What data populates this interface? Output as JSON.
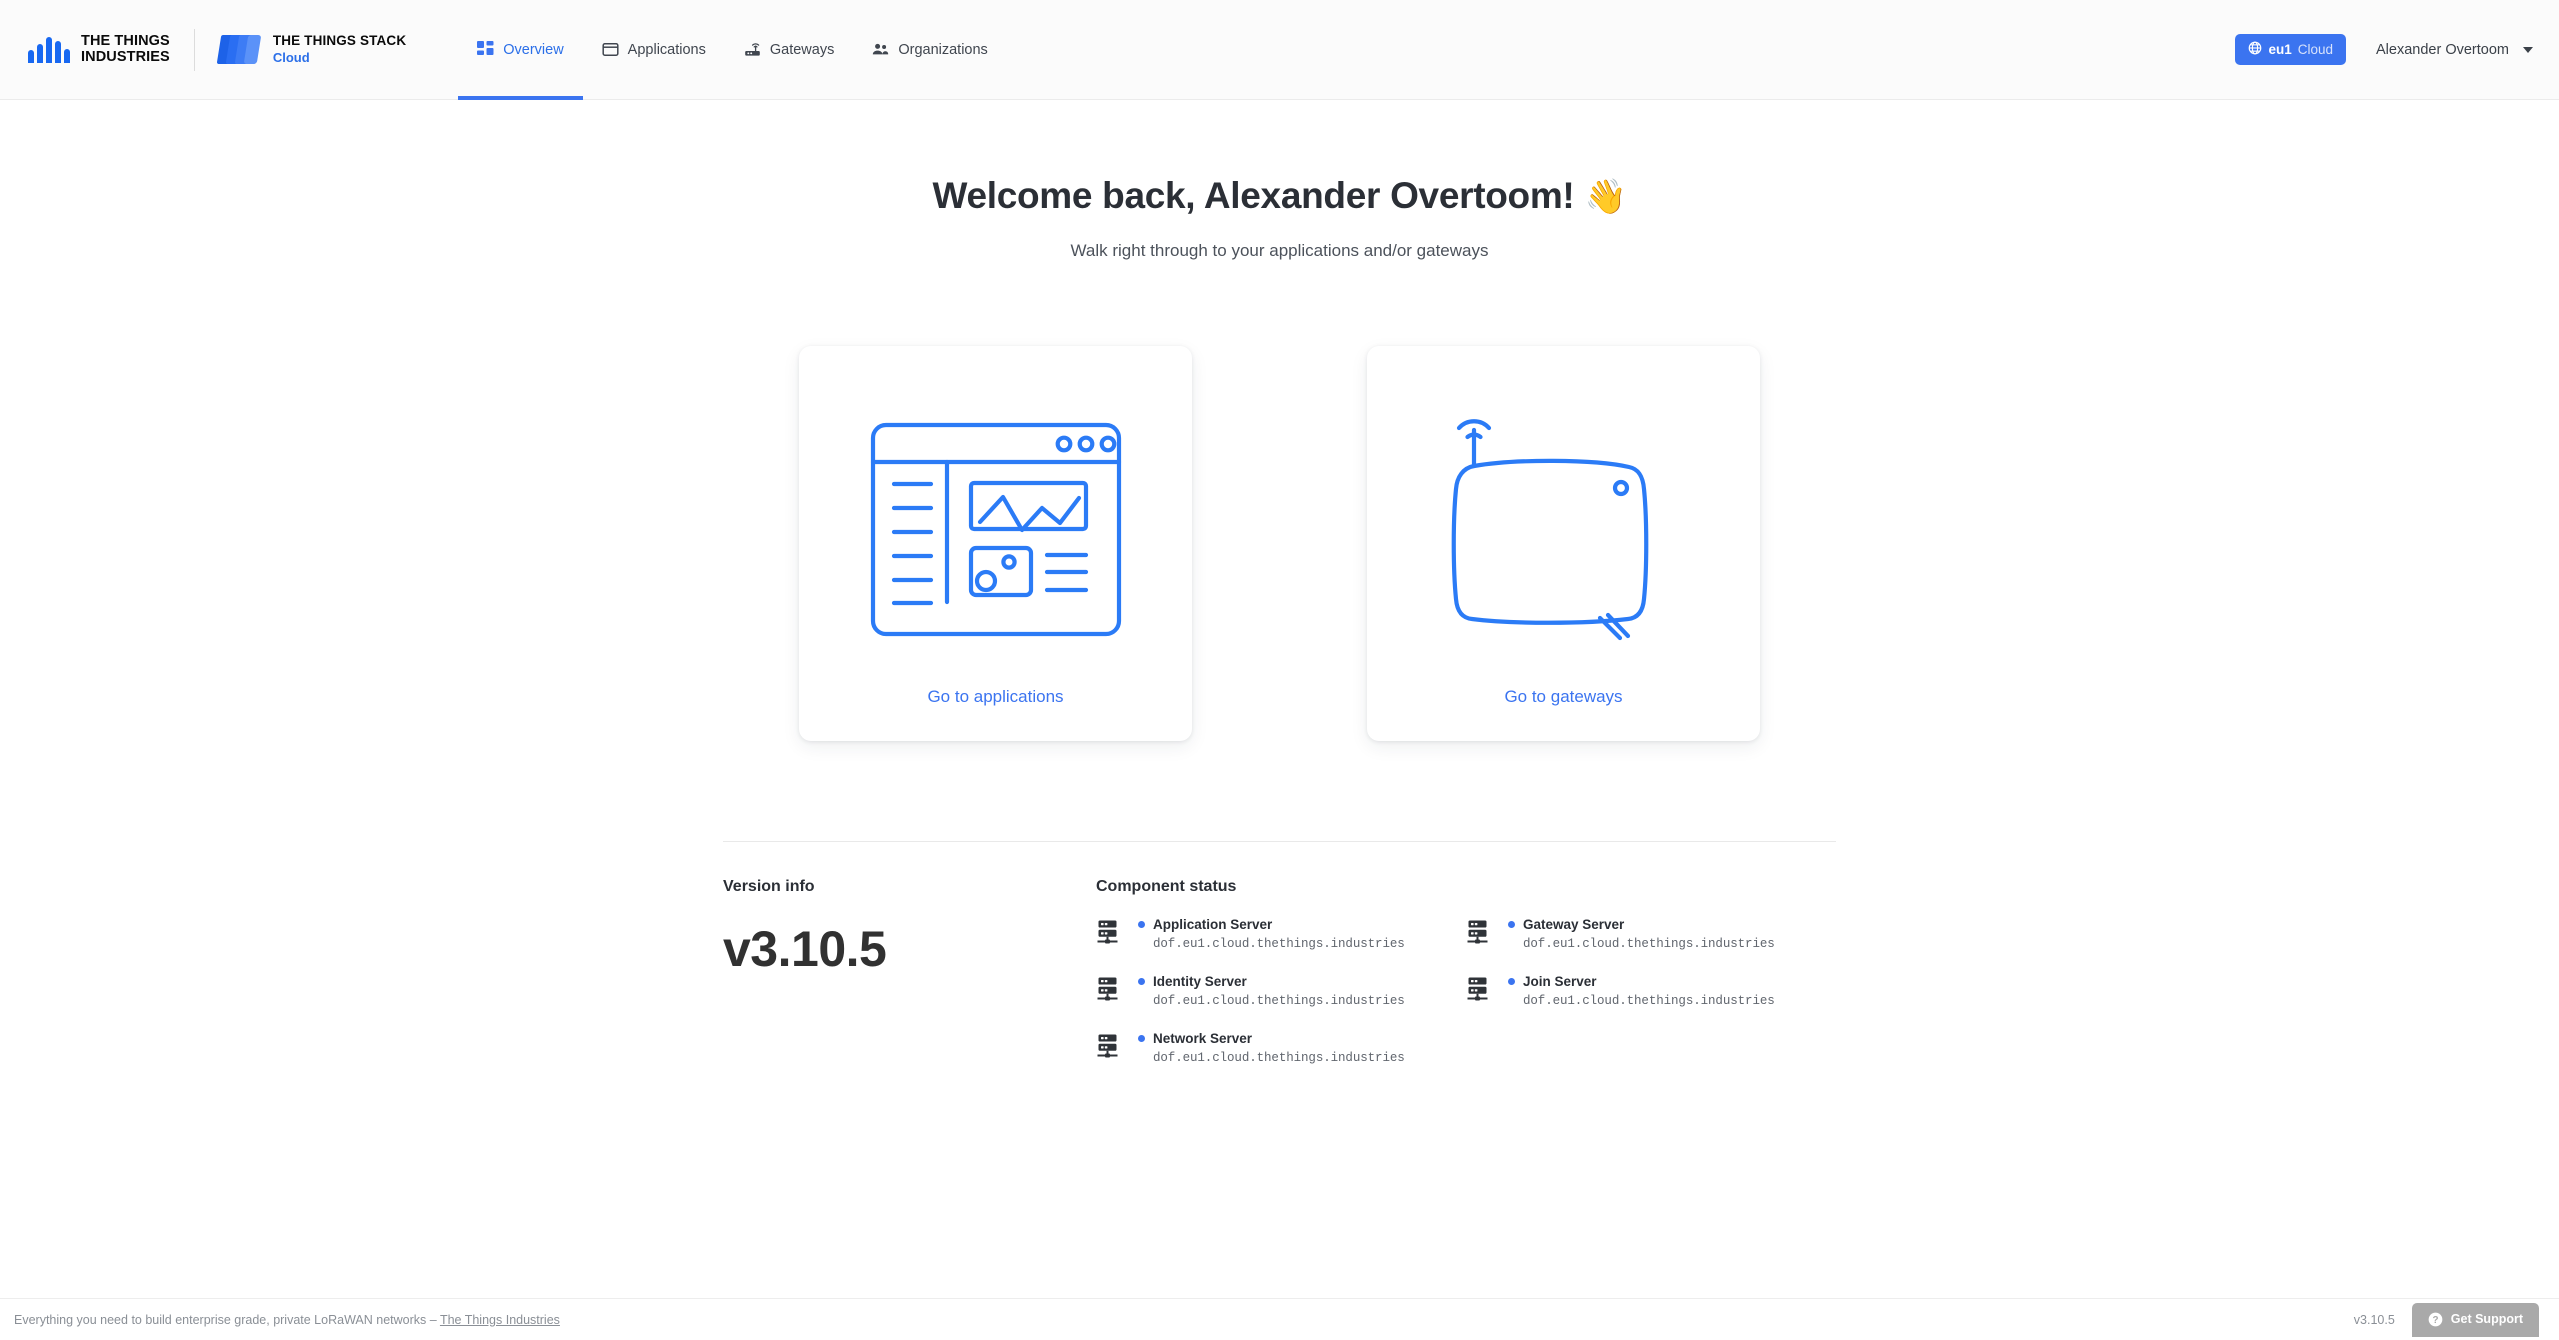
{
  "header": {
    "brand": {
      "tti_line1": "THE THINGS",
      "tti_line2": "INDUSTRIES",
      "stack_title": "THE THINGS STACK",
      "stack_sub": "Cloud"
    },
    "nav": [
      {
        "label": "Overview",
        "icon": "grid-icon",
        "active": true
      },
      {
        "label": "Applications",
        "icon": "window-icon",
        "active": false
      },
      {
        "label": "Gateways",
        "icon": "router-icon",
        "active": false
      },
      {
        "label": "Organizations",
        "icon": "people-icon",
        "active": false
      }
    ],
    "cluster_badge": {
      "region": "eu1",
      "tier": "Cloud",
      "icon": "globe-icon"
    },
    "user": {
      "name": "Alexander Overtoom",
      "caret": "chevron-down-icon"
    }
  },
  "main": {
    "welcome_title": "Welcome back, Alexander Overtoom!",
    "welcome_emoji": "👋",
    "subtitle": "Walk right through to your applications and/or gateways",
    "cards": [
      {
        "link_label": "Go to applications",
        "art": "applications-illustration"
      },
      {
        "link_label": "Go to gateways",
        "art": "gateway-illustration"
      }
    ]
  },
  "info": {
    "version_heading": "Version info",
    "version_value": "v3.10.5",
    "component_heading": "Component status",
    "components": [
      {
        "name": "Application Server",
        "host": "dof.eu1.cloud.thethings.industries",
        "status_color": "#3b74f0"
      },
      {
        "name": "Gateway Server",
        "host": "dof.eu1.cloud.thethings.industries",
        "status_color": "#3b74f0"
      },
      {
        "name": "Identity Server",
        "host": "dof.eu1.cloud.thethings.industries",
        "status_color": "#3b74f0"
      },
      {
        "name": "Join Server",
        "host": "dof.eu1.cloud.thethings.industries",
        "status_color": "#3b74f0"
      },
      {
        "name": "Network Server",
        "host": "dof.eu1.cloud.thethings.industries",
        "status_color": "#3b74f0"
      }
    ]
  },
  "footer": {
    "tagline_prefix": "Everything you need to build enterprise grade, private LoRaWAN networks – ",
    "tagline_link": "The Things Industries",
    "version": "v3.10.5",
    "support_label": "Get Support",
    "support_icon": "question-circle-icon"
  },
  "colors": {
    "accent": "#3b74f0",
    "header_bg": "#fbfbfb",
    "text": "#2b2f36",
    "muted": "#8a8f96",
    "support_gray": "#a9a9a9"
  }
}
